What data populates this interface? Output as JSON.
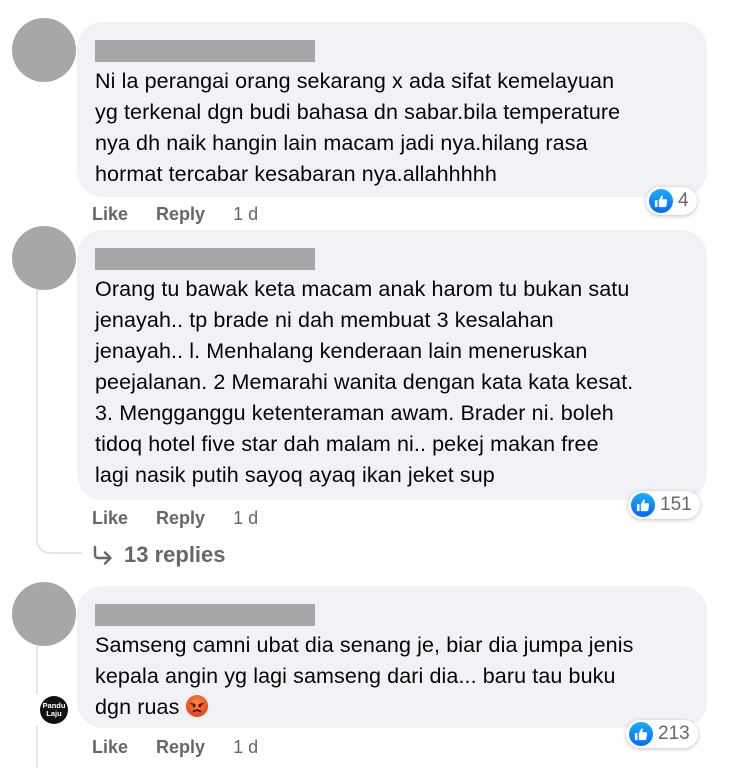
{
  "comments": [
    {
      "text": "Ni la perangai orang sekarang x ada sifat kemelayuan\nyg terkenal dgn budi bahasa dn sabar.bila temperature\nnya dh naik hangin lain macam jadi nya.hilang rasa\nhormat tercabar kesabaran nya.allahhhhh",
      "reaction_count": "4",
      "like_label": "Like",
      "reply_label": "Reply",
      "time": "1 d"
    },
    {
      "text": "Orang tu bawak keta macam anak harom tu bukan satu\njenayah.. tp brade ni dah membuat 3 kesalahan\njenayah.. l. Menhalang kenderaan lain meneruskan\npeejalanan. 2 Memarahi wanita dengan kata kata kesat.\n3. Mengganggu ketenteraman awam. Brader ni. boleh\ntidoq hotel five star dah malam ni.. pekej makan free\nlagi nasik putih sayoq ayaq ikan jeket sup",
      "reaction_count": "151",
      "like_label": "Like",
      "reply_label": "Reply",
      "time": "1 d",
      "replies_label": "13 replies"
    },
    {
      "text": "Samseng camni ubat dia senang je, biar dia jumpa jenis\nkepala angin yg lagi samseng dari dia... baru tau buku\ndgn ruas",
      "reaction_count": "213",
      "like_label": "Like",
      "reply_label": "Reply",
      "time": "1 d",
      "badge_text": "Pandu Laju"
    }
  ],
  "colors": {
    "bubble": "#f0f2f5",
    "secondary_text": "#65676b",
    "like_blue": "#0866ff",
    "avatar_placeholder": "#a7a7a9"
  },
  "icons": [
    "like-icon",
    "reply-arrow-icon",
    "angry-face-emoji"
  ]
}
